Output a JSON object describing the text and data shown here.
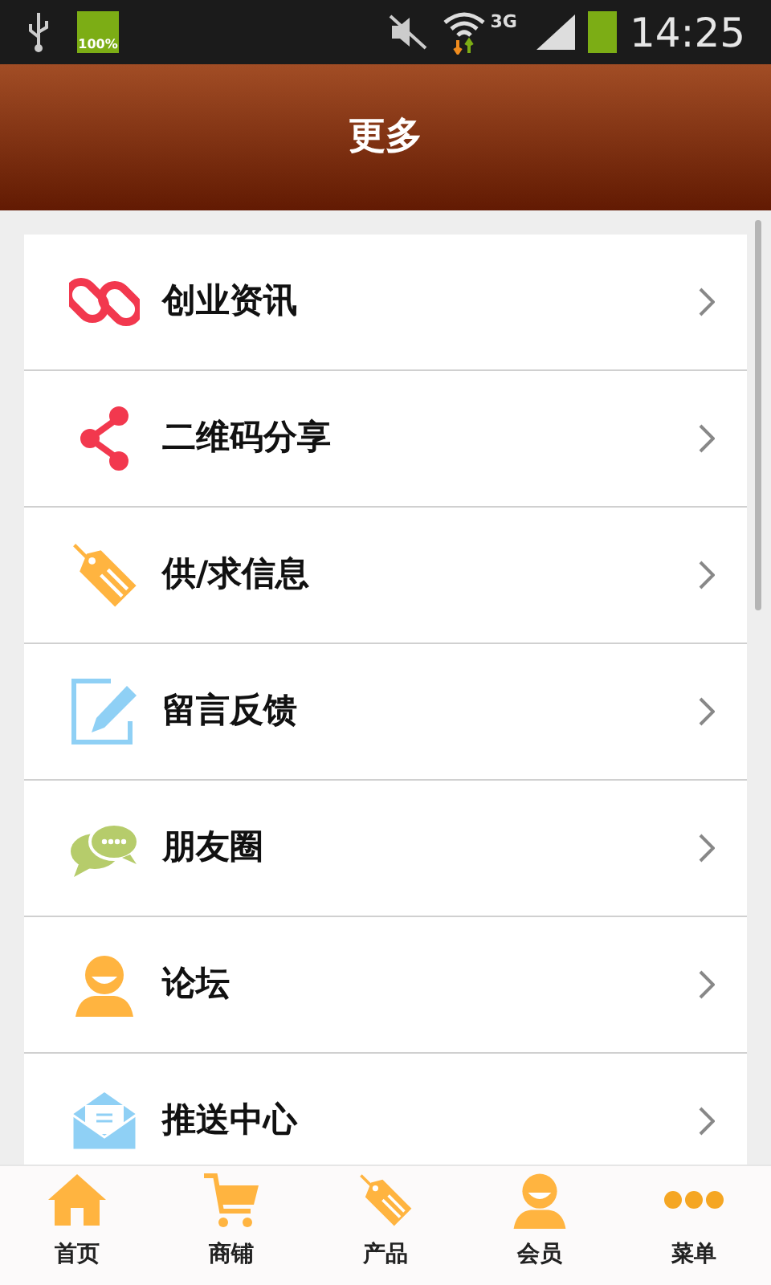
{
  "status_bar": {
    "battery_text": "100%",
    "network": "3G",
    "time": "14:25"
  },
  "header": {
    "title": "更多"
  },
  "menu_items": [
    {
      "label": "创业资讯",
      "kind": "link"
    },
    {
      "label": "二维码分享",
      "kind": "share"
    },
    {
      "label": "供/求信息",
      "kind": "tag"
    },
    {
      "label": "留言反馈",
      "kind": "edit"
    },
    {
      "label": "朋友圈",
      "kind": "chat"
    },
    {
      "label": "论坛",
      "kind": "person"
    },
    {
      "label": "推送中心",
      "kind": "mail"
    }
  ],
  "tab_bar": [
    {
      "label": "首页",
      "kind": "home"
    },
    {
      "label": "商铺",
      "kind": "cart"
    },
    {
      "label": "产品",
      "kind": "tag"
    },
    {
      "label": "会员",
      "kind": "person"
    },
    {
      "label": "菜单",
      "kind": "dots"
    }
  ]
}
